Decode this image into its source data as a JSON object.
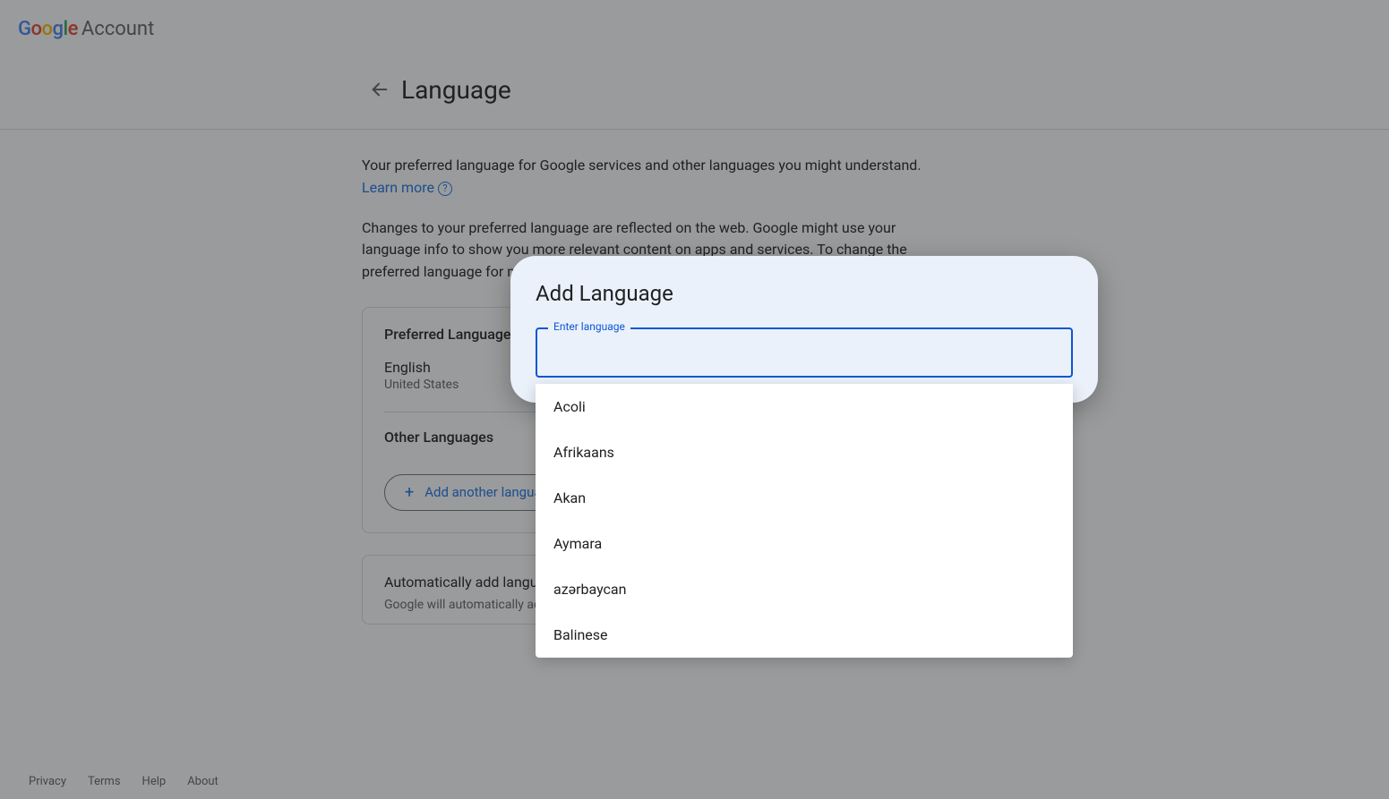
{
  "header": {
    "logo_text": "Google",
    "account_label": "Account"
  },
  "page": {
    "title": "Language",
    "intro_part1": "Your preferred language for Google services and other languages you might understand. ",
    "learn_more": "Learn more",
    "para2": "Changes to your preferred language are reflected on the web. Google might use your language info to show you more relevant content on apps and ser­vices. To change the preferred language for mobile apps, go to the lan­guage settings on your device."
  },
  "card": {
    "preferred_title": "Preferred Language",
    "preferred_lang": "English",
    "preferred_region": "United States",
    "other_title": "Other Languages",
    "add_button": "Add another language"
  },
  "card2": {
    "title": "Automatically add languages",
    "desc": "Google will automatically add languages that you frequently use in Google ser­"
  },
  "footer": {
    "privacy": "Privacy",
    "terms": "Terms",
    "help": "Help",
    "about": "About"
  },
  "dialog": {
    "title": "Add Language",
    "field_label": "Enter language",
    "input_value": "",
    "options": [
      "Acoli",
      "Afrikaans",
      "Akan",
      "Aymara",
      "azərbaycan",
      "Balinese"
    ]
  }
}
